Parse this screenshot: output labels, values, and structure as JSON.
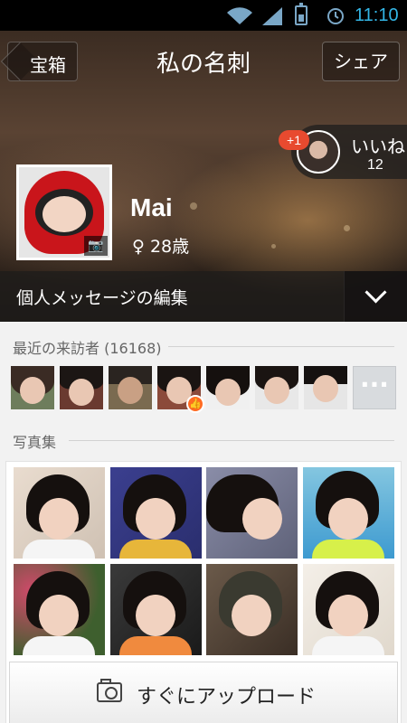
{
  "status_bar": {
    "time": "11:10",
    "icons": [
      "wifi-icon",
      "signal-icon",
      "battery-icon",
      "alarm-icon"
    ]
  },
  "header": {
    "back_label": "宝箱",
    "title": "私の名刺",
    "share_label": "シェア"
  },
  "like": {
    "badge": "+1",
    "label": "いいね",
    "count": "12"
  },
  "profile": {
    "name": "Mai",
    "gender_symbol": "♀",
    "age": "28歳",
    "edit_message_label": "個人メッセージの編集"
  },
  "visitors": {
    "title": "最近の来訪者",
    "count": "(16168)",
    "more_label": "···",
    "items": [
      "visitor-1",
      "visitor-2",
      "visitor-3",
      "visitor-4",
      "visitor-5",
      "visitor-6",
      "visitor-7"
    ]
  },
  "photos": {
    "title": "写真集",
    "upload_label": "すぐにアップロード"
  },
  "colors": {
    "time": "#33b5e5",
    "like_badge": "#e84a2f",
    "thumbs_badge": "#ff6b22"
  }
}
